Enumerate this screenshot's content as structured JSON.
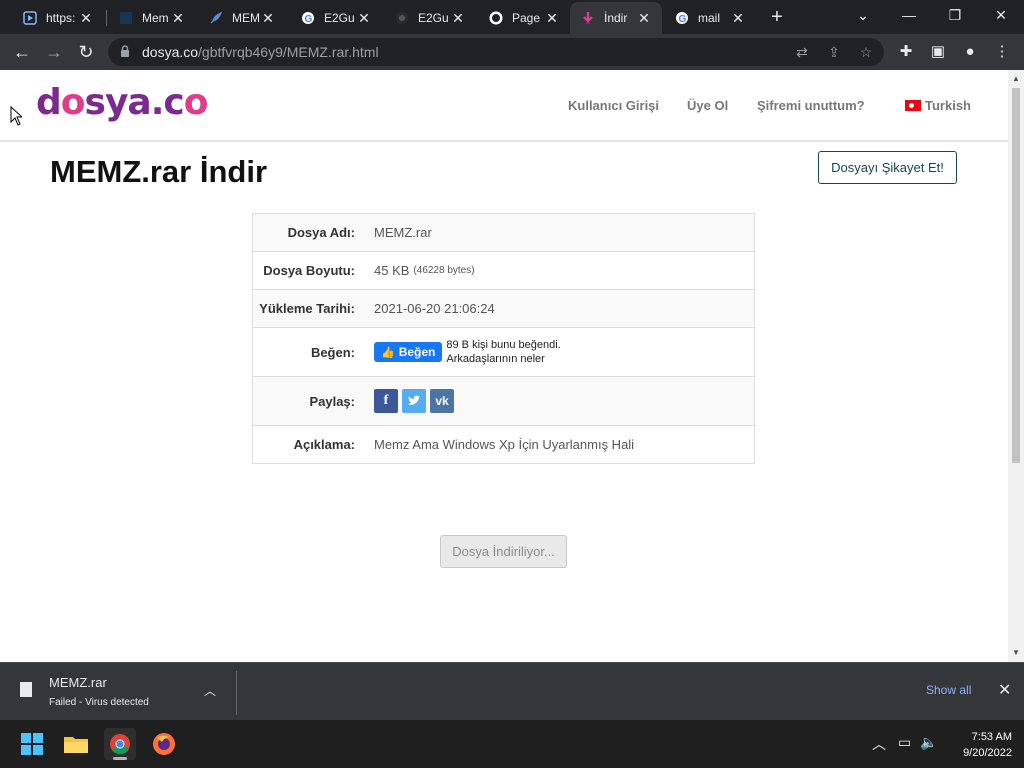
{
  "browser": {
    "tabs": [
      {
        "title": "https:",
        "favicon": "play-icon",
        "active": false
      },
      {
        "title": "Mem",
        "favicon": "dark-square-icon",
        "active": false
      },
      {
        "title": "MEM",
        "favicon": "feather-icon",
        "active": false
      },
      {
        "title": "E2Gu",
        "favicon": "google-icon",
        "active": false
      },
      {
        "title": "E2Gu",
        "favicon": "github-icon",
        "active": false
      },
      {
        "title": "Page",
        "favicon": "github-icon",
        "active": false
      },
      {
        "title": "İndir",
        "favicon": "download-pink-icon",
        "active": true
      },
      {
        "title": "mail",
        "favicon": "google-icon",
        "active": false
      }
    ],
    "url_domain": "dosya.co",
    "url_path": "/gbtfvrqb46y9/MEMZ.rar.html"
  },
  "site": {
    "logo_text_1": "d",
    "logo_text_2": "o",
    "logo_text_3": "sya.c",
    "logo_text_4": "o",
    "nav": {
      "login": "Kullanıcı Girişi",
      "register": "Üye Ol",
      "forgot": "Şifremi unuttum?",
      "language": "Turkish"
    }
  },
  "page": {
    "title": "MEMZ.rar İndir",
    "report_button": "Dosyayı Şikayet Et!",
    "rows": {
      "name_label": "Dosya Adı:",
      "name_value": "MEMZ.rar",
      "size_label": "Dosya Boyutu:",
      "size_value": "45 KB",
      "size_bytes": "(46228 bytes)",
      "date_label": "Yükleme Tarihi:",
      "date_value": "2021-06-20 21:06:24",
      "like_label": "Beğen:",
      "like_button": "Beğen",
      "like_text_1": "89 B kişi bunu beğendi.",
      "like_text_2": "Arkadaşlarının neler",
      "share_label": "Paylaş:",
      "desc_label": "Açıklama:",
      "desc_value": "Memz Ama Windows Xp İçin Uyarlanmış Hali"
    },
    "download_button": "Dosya İndiriliyor..."
  },
  "download_shelf": {
    "file_name": "MEMZ.rar",
    "status": "Failed - Virus detected",
    "show_all": "Show all"
  },
  "taskbar": {
    "time": "7:53 AM",
    "date": "9/20/2022"
  },
  "colors": {
    "brand_purple": "#7b2a8e",
    "brand_pink": "#e03c8c",
    "facebook": "#3b5998",
    "twitter": "#55acee",
    "vk": "#4c75a3",
    "link_blue": "#8ab4f8"
  }
}
